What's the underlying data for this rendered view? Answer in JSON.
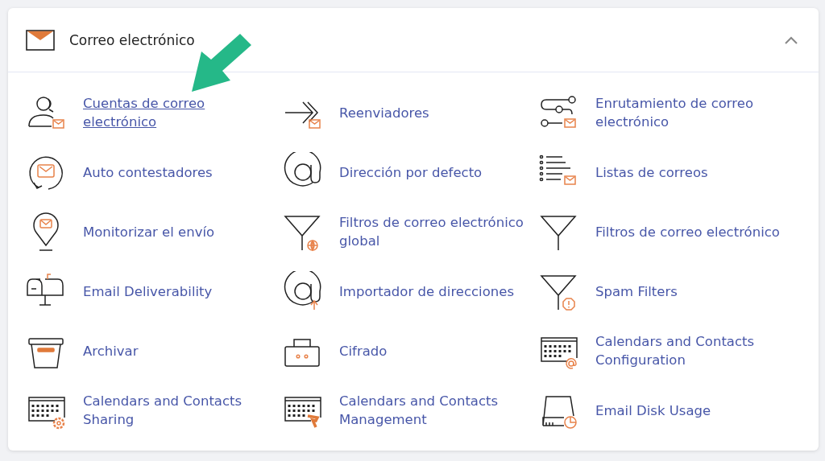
{
  "section": {
    "title": "Correo electrónico",
    "expanded": true
  },
  "callout_arrow": true,
  "items": [
    {
      "label": "Cuentas de correo electrónico",
      "kind": "accounts",
      "hovered": true
    },
    {
      "label": "Reenviadores",
      "kind": "forwarders",
      "hovered": false
    },
    {
      "label": "Enrutamiento de correo electrónico",
      "kind": "routing",
      "hovered": false
    },
    {
      "label": "Auto contestadores",
      "kind": "autoresponder",
      "hovered": false
    },
    {
      "label": "Dirección por defecto",
      "kind": "at",
      "hovered": false
    },
    {
      "label": "Listas de correos",
      "kind": "lists",
      "hovered": false
    },
    {
      "label": "Monitorizar el envío",
      "kind": "pin",
      "hovered": false
    },
    {
      "label": "Filtros de correo electrónico global",
      "kind": "filter-globe",
      "hovered": false
    },
    {
      "label": "Filtros de correo electrónico",
      "kind": "filter",
      "hovered": false
    },
    {
      "label": "Email Deliverability",
      "kind": "mailbox",
      "hovered": false
    },
    {
      "label": "Importador de direcciones",
      "kind": "at-import",
      "hovered": false
    },
    {
      "label": "Spam Filters",
      "kind": "filter-alert",
      "hovered": false
    },
    {
      "label": "Archivar",
      "kind": "archive",
      "hovered": false
    },
    {
      "label": "Cifrado",
      "kind": "lock",
      "hovered": false
    },
    {
      "label": "Calendars and Contacts Configuration",
      "kind": "calendar-at",
      "hovered": false
    },
    {
      "label": "Calendars and Contacts Sharing",
      "kind": "calendar-gear",
      "hovered": false
    },
    {
      "label": "Calendars and Contacts Management",
      "kind": "calendar-hammer",
      "hovered": false
    },
    {
      "label": "Email Disk Usage",
      "kind": "disk",
      "hovered": false
    }
  ]
}
